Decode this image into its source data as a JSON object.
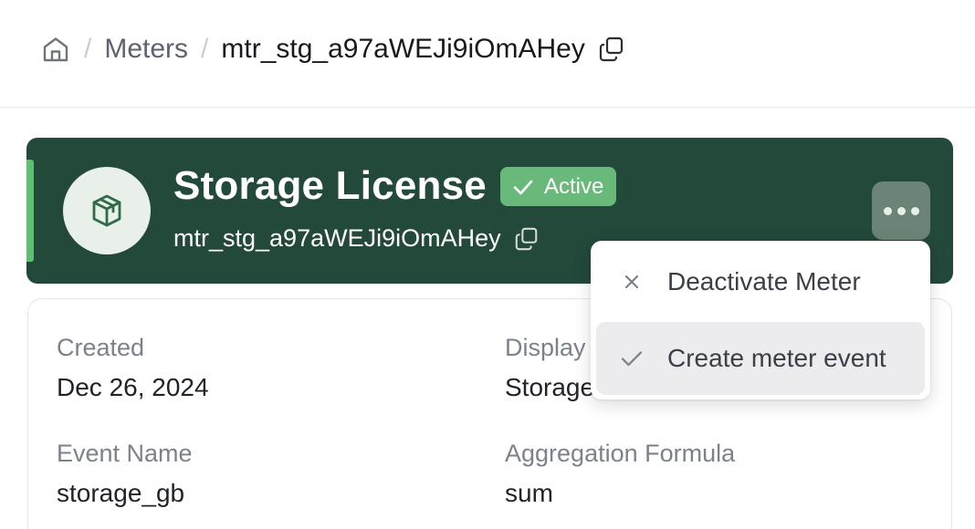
{
  "breadcrumb": {
    "home_icon": "home-icon",
    "separator": "/",
    "parent": "Meters",
    "current": "mtr_stg_a97aWEJi9iOmAHey",
    "copy_icon": "copy-icon"
  },
  "banner": {
    "title": "Storage License",
    "status": "Active",
    "meter_id": "mtr_stg_a97aWEJi9iOmAHey",
    "avatar_icon": "package-icon",
    "more_icon": "more-horizontal-icon",
    "background_color": "#23493a",
    "accent_color": "#5cc070",
    "badge_color": "#69b97b"
  },
  "details": {
    "created_label": "Created",
    "created_value": "Dec 26, 2024",
    "display_label": "Display",
    "display_value": "Storage",
    "event_name_label": "Event Name",
    "event_name_value": "storage_gb",
    "aggregation_label": "Aggregation Formula",
    "aggregation_value": "sum"
  },
  "menu": {
    "items": [
      {
        "label": "Deactivate Meter",
        "icon": "close-icon"
      },
      {
        "label": "Create meter event",
        "icon": "check-icon",
        "highlighted": true
      }
    ]
  }
}
